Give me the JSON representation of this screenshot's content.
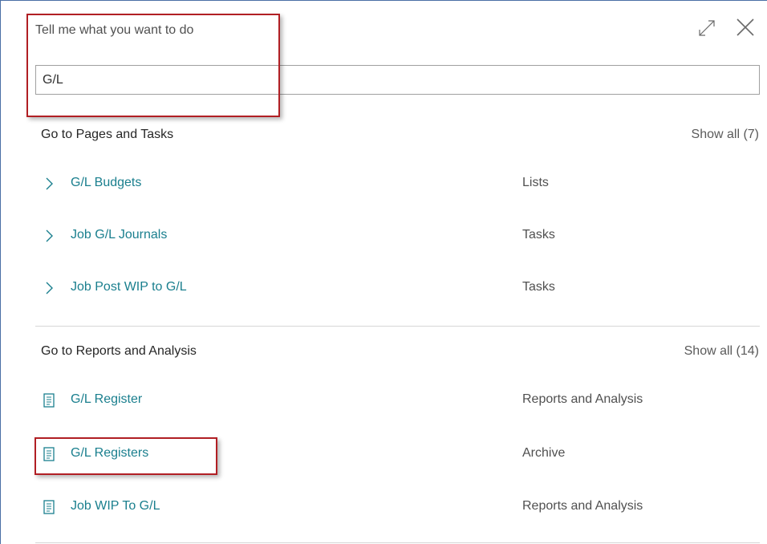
{
  "dialog": {
    "title": "Tell me what you want to do",
    "search_value": "G/L",
    "expand_icon": "expand-icon",
    "close_icon": "close-icon"
  },
  "pages_section": {
    "title": "Go to Pages and Tasks",
    "show_all": "Show all (7)",
    "items": [
      {
        "label": "G/L Budgets",
        "category": "Lists",
        "icon": "chevron-right-icon"
      },
      {
        "label": "Job G/L Journals",
        "category": "Tasks",
        "icon": "chevron-right-icon"
      },
      {
        "label": "Job Post WIP to G/L",
        "category": "Tasks",
        "icon": "chevron-right-icon"
      }
    ]
  },
  "reports_section": {
    "title": "Go to Reports and Analysis",
    "show_all": "Show all (14)",
    "items": [
      {
        "label": "G/L Register",
        "category": "Reports and Analysis",
        "icon": "report-icon"
      },
      {
        "label": "G/L Registers",
        "category": "Archive",
        "icon": "report-icon"
      },
      {
        "label": "Job WIP To G/L",
        "category": "Reports and Analysis",
        "icon": "report-icon"
      }
    ]
  },
  "colors": {
    "link": "#1a7f8e",
    "highlight": "#b11f24",
    "border": "#4a6fa5"
  }
}
